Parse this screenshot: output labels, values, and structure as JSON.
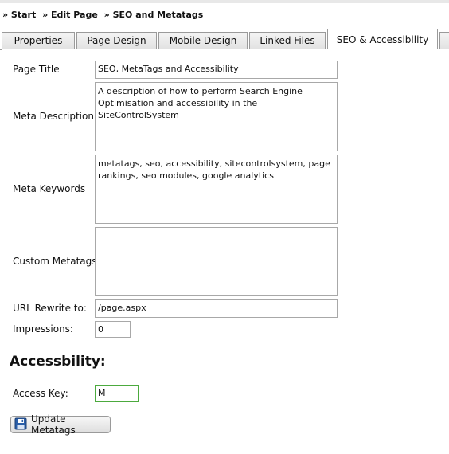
{
  "breadcrumb": {
    "items": [
      "» Start",
      "» Edit Page",
      "» SEO and Metatags"
    ]
  },
  "tabs": [
    {
      "label": "Properties",
      "active": false
    },
    {
      "label": "Page Design",
      "active": false
    },
    {
      "label": "Mobile Design",
      "active": false
    },
    {
      "label": "Linked Files",
      "active": false
    },
    {
      "label": "SEO & Accessibility",
      "active": true
    }
  ],
  "form": {
    "page_title": {
      "label": "Page Title",
      "value": "SEO, MetaTags and Accessibility"
    },
    "meta_description": {
      "label": "Meta Description",
      "value": "A description of how to perform Search Engine Optimisation and accessibility in the SiteControlSystem"
    },
    "meta_keywords": {
      "label": "Meta Keywords",
      "value": "metatags, seo, accessibility, sitecontrolsystem, page rankings, seo modules, google analytics"
    },
    "custom_metatags": {
      "label": "Custom Metatags",
      "value": ""
    },
    "url_rewrite": {
      "label": "URL Rewrite to:",
      "value": "/page.aspx"
    },
    "impressions": {
      "label": "Impressions:",
      "value": "0"
    }
  },
  "accessibility": {
    "heading": "Accessbility:",
    "access_key": {
      "label": "Access Key:",
      "value": "M"
    }
  },
  "actions": {
    "update_label": "Update Metatags",
    "update_icon": "floppy-disk-icon",
    "accent_color": "#4caa3e"
  }
}
